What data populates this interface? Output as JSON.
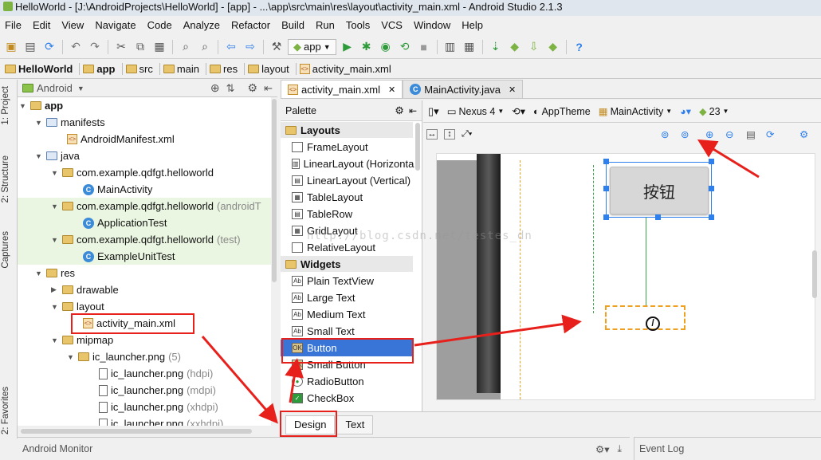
{
  "window": {
    "title": "HelloWorld - [J:\\AndroidProjects\\HelloWorld] - [app] - ...\\app\\src\\main\\res\\layout\\activity_main.xml - Android Studio 2.1.3"
  },
  "menu": [
    "File",
    "Edit",
    "View",
    "Navigate",
    "Code",
    "Analyze",
    "Refactor",
    "Build",
    "Run",
    "Tools",
    "VCS",
    "Window",
    "Help"
  ],
  "toolbar": {
    "run_config": "app"
  },
  "breadcrumbs": [
    "HelloWorld",
    "app",
    "src",
    "main",
    "res",
    "layout",
    "activity_main.xml"
  ],
  "side_tabs": {
    "project": "1: Project",
    "structure": "2: Structure",
    "captures": "Captures",
    "favorites": "2: Favorites"
  },
  "project": {
    "view_mode": "Android",
    "tree": [
      {
        "label": "app",
        "bold": true
      },
      {
        "label": "manifests"
      },
      {
        "label": "AndroidManifest.xml"
      },
      {
        "label": "java"
      },
      {
        "label": "com.example.qdfgt.helloworld",
        "suffix": ""
      },
      {
        "label": "MainActivity"
      },
      {
        "label": "com.example.qdfgt.helloworld",
        "suffix": "(androidT"
      },
      {
        "label": "ApplicationTest"
      },
      {
        "label": "com.example.qdfgt.helloworld",
        "suffix": "(test)"
      },
      {
        "label": "ExampleUnitTest"
      },
      {
        "label": "res"
      },
      {
        "label": "drawable"
      },
      {
        "label": "layout"
      },
      {
        "label": "activity_main.xml"
      },
      {
        "label": "mipmap"
      },
      {
        "label": "ic_launcher.png",
        "suffix": "(5)"
      },
      {
        "label": "ic_launcher.png",
        "suffix": "(hdpi)"
      },
      {
        "label": "ic_launcher.png",
        "suffix": "(mdpi)"
      },
      {
        "label": "ic_launcher.png",
        "suffix": "(xhdpi)"
      },
      {
        "label": "ic_launcher.png",
        "suffix": "(xxhdpi)"
      }
    ]
  },
  "editor": {
    "tabs": [
      {
        "label": "activity_main.xml",
        "active": true
      },
      {
        "label": "MainActivity.java",
        "active": false
      }
    ],
    "bottom_tabs": [
      "Design",
      "Text"
    ]
  },
  "palette": {
    "title": "Palette",
    "groups": [
      {
        "name": "Layouts",
        "items": [
          "FrameLayout",
          "LinearLayout (Horizonta",
          "LinearLayout (Vertical)",
          "TableLayout",
          "TableRow",
          "GridLayout",
          "RelativeLayout"
        ]
      },
      {
        "name": "Widgets",
        "items": [
          "Plain TextView",
          "Large Text",
          "Medium Text",
          "Small Text",
          "Button",
          "Small Button",
          "RadioButton",
          "CheckBox"
        ]
      }
    ],
    "selected": "Button"
  },
  "design_toolbar": {
    "device": "Nexus 4",
    "theme": "AppTheme",
    "activity": "MainActivity",
    "api": "23"
  },
  "preview": {
    "button_text": "按钮"
  },
  "watermark": "http://blog.csdn.net/testes_dn",
  "bottom": {
    "monitor": "Android Monitor",
    "event_log": "Event Log"
  }
}
